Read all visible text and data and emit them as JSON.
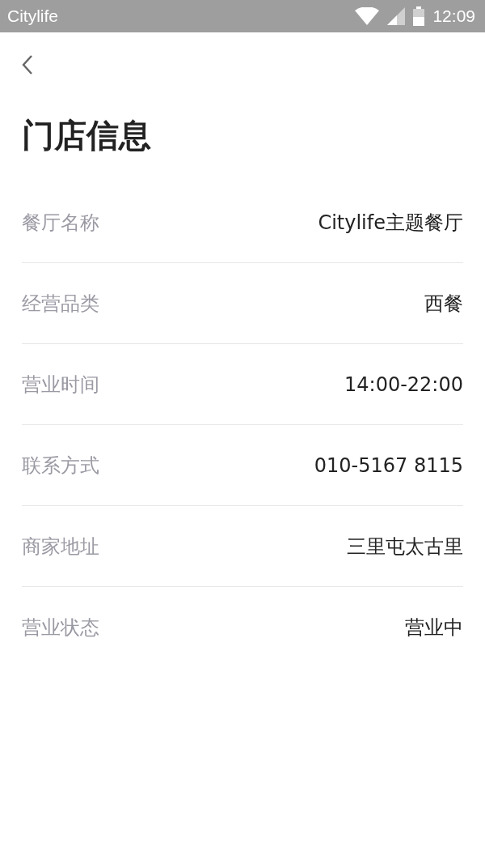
{
  "status_bar": {
    "app_name": "Citylife",
    "time": "12:09"
  },
  "title": "门店信息",
  "rows": [
    {
      "label": "餐厅名称",
      "value": "Citylife主题餐厅"
    },
    {
      "label": "经营品类",
      "value": "西餐"
    },
    {
      "label": "营业时间",
      "value": "14:00-22:00"
    },
    {
      "label": "联系方式",
      "value": "010-5167 8115"
    },
    {
      "label": "商家地址",
      "value": "三里屯太古里"
    },
    {
      "label": "营业状态",
      "value": "营业中"
    }
  ]
}
